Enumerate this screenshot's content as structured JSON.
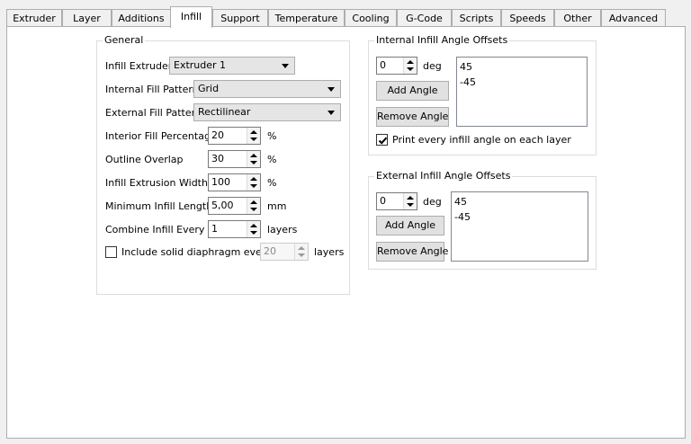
{
  "tabs": [
    {
      "label": "Extruder"
    },
    {
      "label": "Layer"
    },
    {
      "label": "Additions"
    },
    {
      "label": "Infill"
    },
    {
      "label": "Support"
    },
    {
      "label": "Temperature"
    },
    {
      "label": "Cooling"
    },
    {
      "label": "G-Code"
    },
    {
      "label": "Scripts"
    },
    {
      "label": "Speeds"
    },
    {
      "label": "Other"
    },
    {
      "label": "Advanced"
    }
  ],
  "active_tab": "Infill",
  "general": {
    "title": "General",
    "infill_extruder": {
      "label": "Infill Extruder",
      "value": "Extruder 1"
    },
    "internal_fill_pattern": {
      "label": "Internal Fill Pattern",
      "value": "Grid"
    },
    "external_fill_pattern": {
      "label": "External Fill Pattern",
      "value": "Rectilinear"
    },
    "interior_fill_percentage": {
      "label": "Interior Fill Percentage",
      "value": "20",
      "unit": "%"
    },
    "outline_overlap": {
      "label": "Outline Overlap",
      "value": "30",
      "unit": "%"
    },
    "infill_extrusion_width": {
      "label": "Infill Extrusion Width",
      "value": "100",
      "unit": "%"
    },
    "minimum_infill_length": {
      "label": "Minimum Infill Length",
      "value": "5,00",
      "unit": "mm"
    },
    "combine_infill_every": {
      "label": "Combine Infill Every",
      "value": "1",
      "unit": "layers"
    },
    "solid_diaphragm": {
      "label": "Include solid diaphragm every",
      "value": "20",
      "unit": "layers",
      "checked": false
    }
  },
  "internal_offsets": {
    "title": "Internal Infill Angle Offsets",
    "angle_value": "0",
    "angle_unit": "deg",
    "add_label": "Add Angle",
    "remove_label": "Remove Angle",
    "angles": [
      "45",
      "-45"
    ],
    "print_every_label": "Print every infill angle on each layer",
    "print_every_checked": true
  },
  "external_offsets": {
    "title": "External Infill Angle Offsets",
    "angle_value": "0",
    "angle_unit": "deg",
    "add_label": "Add Angle",
    "remove_label": "Remove Angle",
    "angles": [
      "45",
      "-45"
    ]
  }
}
